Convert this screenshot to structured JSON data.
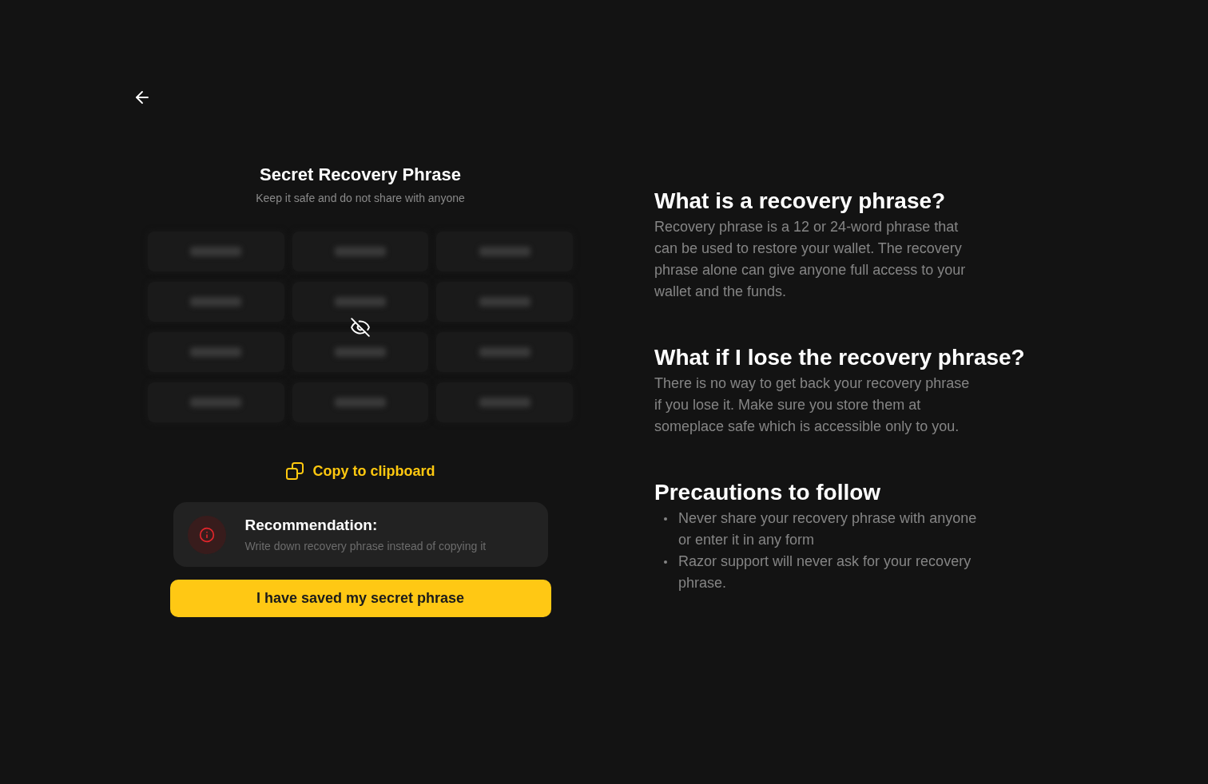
{
  "header": {
    "title": "Secret Recovery Phrase",
    "subtitle": "Keep it safe and do not share with anyone"
  },
  "phrase_grid": {
    "hidden": true,
    "cells": [
      {
        "blurred": true
      },
      {
        "blurred": true
      },
      {
        "blurred": true
      },
      {
        "blurred": true
      },
      {
        "blurred": true
      },
      {
        "blurred": true
      },
      {
        "blurred": true
      },
      {
        "blurred": true
      },
      {
        "blurred": true
      },
      {
        "blurred": true
      },
      {
        "blurred": true
      },
      {
        "blurred": true
      }
    ]
  },
  "copy_link": {
    "label": "Copy to clipboard"
  },
  "recommendation": {
    "title": "Recommendation:",
    "text": "Write down recovery phrase instead of copying it"
  },
  "confirm_button": {
    "label": "I have saved my secret phrase"
  },
  "faq": [
    {
      "kind": "paragraph",
      "heading": "What is a recovery phrase?",
      "body": "Recovery phrase is a 12 or 24-word phrase that can be used to restore your wallet. The recovery phrase alone can give anyone full access to your wallet and the funds."
    },
    {
      "kind": "paragraph",
      "heading": "What if I lose the recovery phrase?",
      "body": "There is no way to get back your recovery phrase if you lose it. Make sure you store them at someplace safe which is accessible only to you."
    },
    {
      "kind": "bullets",
      "heading": "Precautions to follow",
      "items": [
        "Never share your recovery phrase with anyone or enter it in any form",
        "Razor support will never ask for your recovery phrase."
      ]
    }
  ]
}
